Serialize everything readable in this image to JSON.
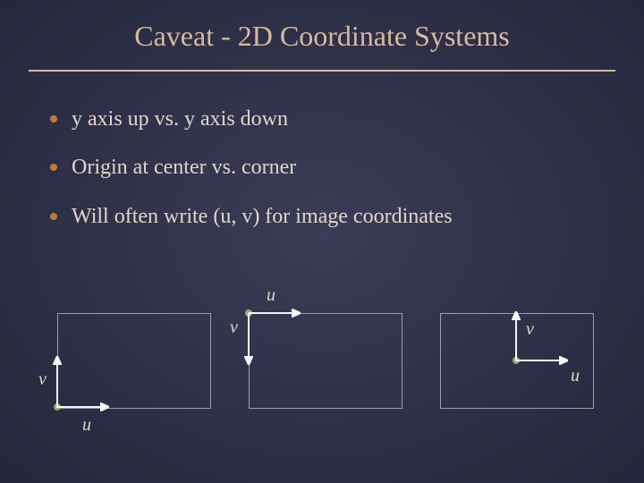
{
  "title": "Caveat - 2D Coordinate Systems",
  "bullets": [
    "y axis up vs. y axis down",
    "Origin at center vs. corner",
    "Will often write (u, v) for image coordinates"
  ],
  "diagrams": {
    "left": {
      "u_label": "u",
      "v_label": "v",
      "origin": "bottom-left",
      "u_direction": "right",
      "v_direction": "up"
    },
    "middle": {
      "u_label": "u",
      "v_label": "v",
      "origin": "top-left",
      "u_direction": "right",
      "v_direction": "down"
    },
    "right": {
      "u_label": "u",
      "v_label": "v",
      "origin": "center",
      "u_direction": "right",
      "v_direction": "up"
    }
  },
  "colors": {
    "accent": "#d8ba9d",
    "bullet_dot": "#c07a3a",
    "axis": "#f5f5f5",
    "box_border": "#9a9db3",
    "body_text": "#e3d6c6",
    "origin_point": "#a4a76a"
  }
}
